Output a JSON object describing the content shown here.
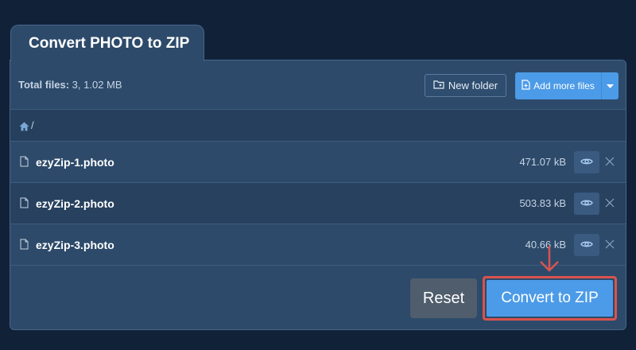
{
  "tab": {
    "title": "Convert PHOTO to ZIP"
  },
  "header": {
    "total_label": "Total files:",
    "total_value": "3, 1.02 MB",
    "new_folder_label": "New folder",
    "add_more_label": "Add more files"
  },
  "breadcrumb": {
    "path": "/"
  },
  "files": [
    {
      "name": "ezyZip-1.photo",
      "size": "471.07 kB"
    },
    {
      "name": "ezyZip-2.photo",
      "size": "503.83 kB"
    },
    {
      "name": "ezyZip-3.photo",
      "size": "40.66 kB"
    }
  ],
  "actions": {
    "reset_label": "Reset",
    "convert_label": "Convert to ZIP"
  },
  "colors": {
    "primary": "#4c9be8",
    "highlight": "#d9534f",
    "panel": "#2d4a6a",
    "background": "#112238"
  },
  "icons": [
    "folder-plus-icon",
    "file-plus-icon",
    "chevron-down-icon",
    "home-icon",
    "file-icon",
    "eye-icon",
    "close-icon",
    "arrow-down-icon"
  ]
}
